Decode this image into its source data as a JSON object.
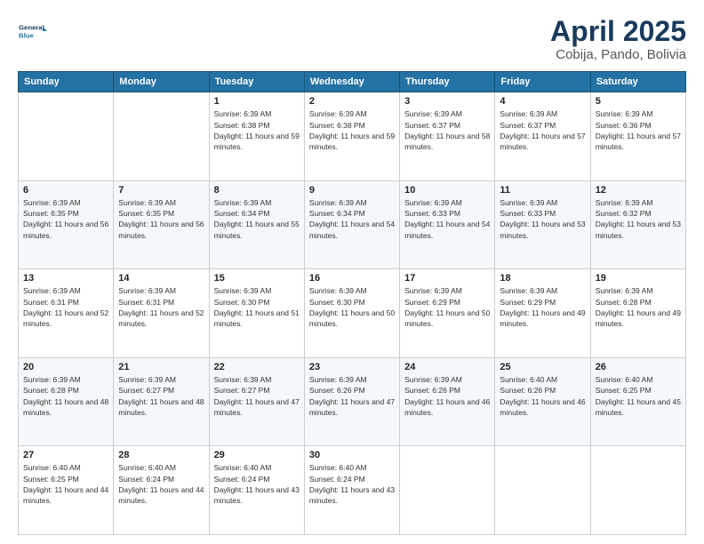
{
  "header": {
    "logo_line1": "General",
    "logo_line2": "Blue",
    "title": "April 2025",
    "subtitle": "Cobija, Pando, Bolivia"
  },
  "weekdays": [
    "Sunday",
    "Monday",
    "Tuesday",
    "Wednesday",
    "Thursday",
    "Friday",
    "Saturday"
  ],
  "weeks": [
    [
      {
        "day": "",
        "info": ""
      },
      {
        "day": "",
        "info": ""
      },
      {
        "day": "1",
        "info": "Sunrise: 6:39 AM\nSunset: 6:38 PM\nDaylight: 11 hours and 59 minutes."
      },
      {
        "day": "2",
        "info": "Sunrise: 6:39 AM\nSunset: 6:38 PM\nDaylight: 11 hours and 59 minutes."
      },
      {
        "day": "3",
        "info": "Sunrise: 6:39 AM\nSunset: 6:37 PM\nDaylight: 11 hours and 58 minutes."
      },
      {
        "day": "4",
        "info": "Sunrise: 6:39 AM\nSunset: 6:37 PM\nDaylight: 11 hours and 57 minutes."
      },
      {
        "day": "5",
        "info": "Sunrise: 6:39 AM\nSunset: 6:36 PM\nDaylight: 11 hours and 57 minutes."
      }
    ],
    [
      {
        "day": "6",
        "info": "Sunrise: 6:39 AM\nSunset: 6:35 PM\nDaylight: 11 hours and 56 minutes."
      },
      {
        "day": "7",
        "info": "Sunrise: 6:39 AM\nSunset: 6:35 PM\nDaylight: 11 hours and 56 minutes."
      },
      {
        "day": "8",
        "info": "Sunrise: 6:39 AM\nSunset: 6:34 PM\nDaylight: 11 hours and 55 minutes."
      },
      {
        "day": "9",
        "info": "Sunrise: 6:39 AM\nSunset: 6:34 PM\nDaylight: 11 hours and 54 minutes."
      },
      {
        "day": "10",
        "info": "Sunrise: 6:39 AM\nSunset: 6:33 PM\nDaylight: 11 hours and 54 minutes."
      },
      {
        "day": "11",
        "info": "Sunrise: 6:39 AM\nSunset: 6:33 PM\nDaylight: 11 hours and 53 minutes."
      },
      {
        "day": "12",
        "info": "Sunrise: 6:39 AM\nSunset: 6:32 PM\nDaylight: 11 hours and 53 minutes."
      }
    ],
    [
      {
        "day": "13",
        "info": "Sunrise: 6:39 AM\nSunset: 6:31 PM\nDaylight: 11 hours and 52 minutes."
      },
      {
        "day": "14",
        "info": "Sunrise: 6:39 AM\nSunset: 6:31 PM\nDaylight: 11 hours and 52 minutes."
      },
      {
        "day": "15",
        "info": "Sunrise: 6:39 AM\nSunset: 6:30 PM\nDaylight: 11 hours and 51 minutes."
      },
      {
        "day": "16",
        "info": "Sunrise: 6:39 AM\nSunset: 6:30 PM\nDaylight: 11 hours and 50 minutes."
      },
      {
        "day": "17",
        "info": "Sunrise: 6:39 AM\nSunset: 6:29 PM\nDaylight: 11 hours and 50 minutes."
      },
      {
        "day": "18",
        "info": "Sunrise: 6:39 AM\nSunset: 6:29 PM\nDaylight: 11 hours and 49 minutes."
      },
      {
        "day": "19",
        "info": "Sunrise: 6:39 AM\nSunset: 6:28 PM\nDaylight: 11 hours and 49 minutes."
      }
    ],
    [
      {
        "day": "20",
        "info": "Sunrise: 6:39 AM\nSunset: 6:28 PM\nDaylight: 11 hours and 48 minutes."
      },
      {
        "day": "21",
        "info": "Sunrise: 6:39 AM\nSunset: 6:27 PM\nDaylight: 11 hours and 48 minutes."
      },
      {
        "day": "22",
        "info": "Sunrise: 6:39 AM\nSunset: 6:27 PM\nDaylight: 11 hours and 47 minutes."
      },
      {
        "day": "23",
        "info": "Sunrise: 6:39 AM\nSunset: 6:26 PM\nDaylight: 11 hours and 47 minutes."
      },
      {
        "day": "24",
        "info": "Sunrise: 6:39 AM\nSunset: 6:26 PM\nDaylight: 11 hours and 46 minutes."
      },
      {
        "day": "25",
        "info": "Sunrise: 6:40 AM\nSunset: 6:26 PM\nDaylight: 11 hours and 46 minutes."
      },
      {
        "day": "26",
        "info": "Sunrise: 6:40 AM\nSunset: 6:25 PM\nDaylight: 11 hours and 45 minutes."
      }
    ],
    [
      {
        "day": "27",
        "info": "Sunrise: 6:40 AM\nSunset: 6:25 PM\nDaylight: 11 hours and 44 minutes."
      },
      {
        "day": "28",
        "info": "Sunrise: 6:40 AM\nSunset: 6:24 PM\nDaylight: 11 hours and 44 minutes."
      },
      {
        "day": "29",
        "info": "Sunrise: 6:40 AM\nSunset: 6:24 PM\nDaylight: 11 hours and 43 minutes."
      },
      {
        "day": "30",
        "info": "Sunrise: 6:40 AM\nSunset: 6:24 PM\nDaylight: 11 hours and 43 minutes."
      },
      {
        "day": "",
        "info": ""
      },
      {
        "day": "",
        "info": ""
      },
      {
        "day": "",
        "info": ""
      }
    ]
  ]
}
